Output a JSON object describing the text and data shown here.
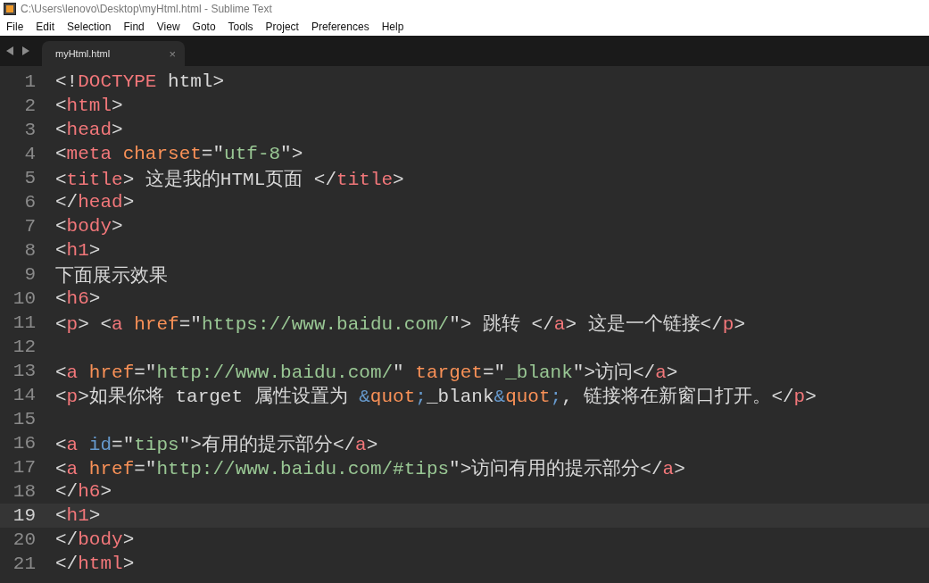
{
  "window": {
    "title": "C:\\Users\\lenovo\\Desktop\\myHtml.html - Sublime Text"
  },
  "menu": [
    "File",
    "Edit",
    "Selection",
    "Find",
    "View",
    "Goto",
    "Tools",
    "Project",
    "Preferences",
    "Help"
  ],
  "tabs": [
    {
      "label": "myHtml.html",
      "selected": true,
      "close": "×"
    }
  ],
  "lines": [
    {
      "number": "1",
      "selected": false,
      "tokens": [
        {
          "kind": "punct",
          "text": "<!"
        },
        {
          "kind": "tag",
          "text": "DOCTYPE"
        },
        {
          "kind": "text",
          "text": " html"
        },
        {
          "kind": "punct",
          "text": ">"
        }
      ]
    },
    {
      "number": "2",
      "selected": false,
      "tokens": [
        {
          "kind": "punct",
          "text": "<"
        },
        {
          "kind": "tag",
          "text": "html"
        },
        {
          "kind": "punct",
          "text": ">"
        }
      ]
    },
    {
      "number": "3",
      "selected": false,
      "tokens": [
        {
          "kind": "punct",
          "text": "<"
        },
        {
          "kind": "tag",
          "text": "head"
        },
        {
          "kind": "punct",
          "text": ">"
        }
      ]
    },
    {
      "number": "4",
      "selected": false,
      "tokens": [
        {
          "kind": "punct",
          "text": "<"
        },
        {
          "kind": "tag",
          "text": "meta"
        },
        {
          "kind": "attr",
          "text": " charset"
        },
        {
          "kind": "punct",
          "text": "=\""
        },
        {
          "kind": "string",
          "text": "utf-8"
        },
        {
          "kind": "punct",
          "text": "\">"
        }
      ]
    },
    {
      "number": "5",
      "selected": false,
      "tokens": [
        {
          "kind": "punct",
          "text": "<"
        },
        {
          "kind": "tag",
          "text": "title"
        },
        {
          "kind": "punct",
          "text": ">"
        },
        {
          "kind": "text",
          "text": " 这是我的HTML页面 "
        },
        {
          "kind": "punct",
          "text": "</"
        },
        {
          "kind": "tag",
          "text": "title"
        },
        {
          "kind": "punct",
          "text": ">"
        }
      ]
    },
    {
      "number": "6",
      "selected": false,
      "tokens": [
        {
          "kind": "punct",
          "text": "</"
        },
        {
          "kind": "tag",
          "text": "head"
        },
        {
          "kind": "punct",
          "text": ">"
        }
      ]
    },
    {
      "number": "7",
      "selected": false,
      "tokens": [
        {
          "kind": "punct",
          "text": "<"
        },
        {
          "kind": "tag",
          "text": "body"
        },
        {
          "kind": "punct",
          "text": ">"
        }
      ]
    },
    {
      "number": "8",
      "selected": false,
      "tokens": [
        {
          "kind": "punct",
          "text": "<"
        },
        {
          "kind": "tag",
          "text": "h1"
        },
        {
          "kind": "punct",
          "text": ">"
        }
      ]
    },
    {
      "number": "9",
      "selected": false,
      "tokens": [
        {
          "kind": "text",
          "text": "下面展示效果"
        }
      ]
    },
    {
      "number": "10",
      "selected": false,
      "tokens": [
        {
          "kind": "punct",
          "text": "<"
        },
        {
          "kind": "tag",
          "text": "h6"
        },
        {
          "kind": "punct",
          "text": ">"
        }
      ]
    },
    {
      "number": "11",
      "selected": false,
      "tokens": [
        {
          "kind": "punct",
          "text": "<"
        },
        {
          "kind": "tag",
          "text": "p"
        },
        {
          "kind": "punct",
          "text": "> <"
        },
        {
          "kind": "tag",
          "text": "a"
        },
        {
          "kind": "attr",
          "text": " href"
        },
        {
          "kind": "punct",
          "text": "=\""
        },
        {
          "kind": "string",
          "text": "https://www.baidu.com/"
        },
        {
          "kind": "punct",
          "text": "\">"
        },
        {
          "kind": "text",
          "text": " 跳转 "
        },
        {
          "kind": "punct",
          "text": "</"
        },
        {
          "kind": "tag",
          "text": "a"
        },
        {
          "kind": "punct",
          "text": ">"
        },
        {
          "kind": "text",
          "text": " 这是一个链接"
        },
        {
          "kind": "punct",
          "text": "</"
        },
        {
          "kind": "tag",
          "text": "p"
        },
        {
          "kind": "punct",
          "text": ">"
        }
      ]
    },
    {
      "number": "12",
      "selected": false
    },
    {
      "number": "13",
      "selected": false,
      "tokens": [
        {
          "kind": "punct",
          "text": "<"
        },
        {
          "kind": "tag",
          "text": "a"
        },
        {
          "kind": "attr",
          "text": " href"
        },
        {
          "kind": "punct",
          "text": "=\""
        },
        {
          "kind": "string",
          "text": "http://www.baidu.com/"
        },
        {
          "kind": "punct",
          "text": "\" "
        },
        {
          "kind": "attr",
          "text": "target"
        },
        {
          "kind": "punct",
          "text": "=\""
        },
        {
          "kind": "string",
          "text": "_blank"
        },
        {
          "kind": "punct",
          "text": "\">"
        },
        {
          "kind": "text",
          "text": "访问"
        },
        {
          "kind": "punct",
          "text": "</"
        },
        {
          "kind": "tag",
          "text": "a"
        },
        {
          "kind": "punct",
          "text": ">"
        }
      ]
    },
    {
      "number": "14",
      "selected": false,
      "tokens": [
        {
          "kind": "punct",
          "text": "<"
        },
        {
          "kind": "tag",
          "text": "p"
        },
        {
          "kind": "punct",
          "text": ">"
        },
        {
          "kind": "text",
          "text": "如果你将 target 属性设置为 "
        },
        {
          "kind": "entity",
          "text": "&"
        },
        {
          "kind": "attr",
          "text": "quot"
        },
        {
          "kind": "entity",
          "text": ";"
        },
        {
          "kind": "text",
          "text": "_blank"
        },
        {
          "kind": "entity",
          "text": "&"
        },
        {
          "kind": "attr",
          "text": "quot"
        },
        {
          "kind": "entity",
          "text": ";"
        },
        {
          "kind": "text",
          "text": ", 链接将在新窗口打开。"
        },
        {
          "kind": "punct",
          "text": "</"
        },
        {
          "kind": "tag",
          "text": "p"
        },
        {
          "kind": "punct",
          "text": ">"
        }
      ]
    },
    {
      "number": "15",
      "selected": false
    },
    {
      "number": "16",
      "selected": false,
      "tokens": [
        {
          "kind": "punct",
          "text": "<"
        },
        {
          "kind": "tag",
          "text": "a"
        },
        {
          "kind": "entity",
          "text": " id"
        },
        {
          "kind": "punct",
          "text": "=\""
        },
        {
          "kind": "string",
          "text": "tips"
        },
        {
          "kind": "punct",
          "text": "\">"
        },
        {
          "kind": "text",
          "text": "有用的提示部分"
        },
        {
          "kind": "punct",
          "text": "</"
        },
        {
          "kind": "tag",
          "text": "a"
        },
        {
          "kind": "punct",
          "text": ">"
        }
      ]
    },
    {
      "number": "17",
      "selected": false,
      "tokens": [
        {
          "kind": "punct",
          "text": "<"
        },
        {
          "kind": "tag",
          "text": "a"
        },
        {
          "kind": "attr",
          "text": " href"
        },
        {
          "kind": "punct",
          "text": "=\""
        },
        {
          "kind": "string",
          "text": "http://www.baidu.com/#tips"
        },
        {
          "kind": "punct",
          "text": "\">"
        },
        {
          "kind": "text",
          "text": "访问有用的提示部分"
        },
        {
          "kind": "punct",
          "text": "</"
        },
        {
          "kind": "tag",
          "text": "a"
        },
        {
          "kind": "punct",
          "text": ">"
        }
      ]
    },
    {
      "number": "18",
      "selected": false,
      "tokens": [
        {
          "kind": "punct",
          "text": "</"
        },
        {
          "kind": "tag",
          "text": "h6"
        },
        {
          "kind": "punct",
          "text": ">"
        }
      ]
    },
    {
      "number": "19",
      "selected": true,
      "tokens": [
        {
          "kind": "punct",
          "text": "<"
        },
        {
          "kind": "tag",
          "text": "h1"
        },
        {
          "kind": "punct",
          "text": ">"
        }
      ]
    },
    {
      "number": "20",
      "selected": false,
      "tokens": [
        {
          "kind": "punct",
          "text": "</"
        },
        {
          "kind": "tag",
          "text": "body"
        },
        {
          "kind": "punct",
          "text": ">"
        }
      ]
    },
    {
      "number": "21",
      "selected": false,
      "tokens": [
        {
          "kind": "punct",
          "text": "</"
        },
        {
          "kind": "tag",
          "text": "html"
        },
        {
          "kind": "punct",
          "text": ">"
        }
      ]
    }
  ]
}
